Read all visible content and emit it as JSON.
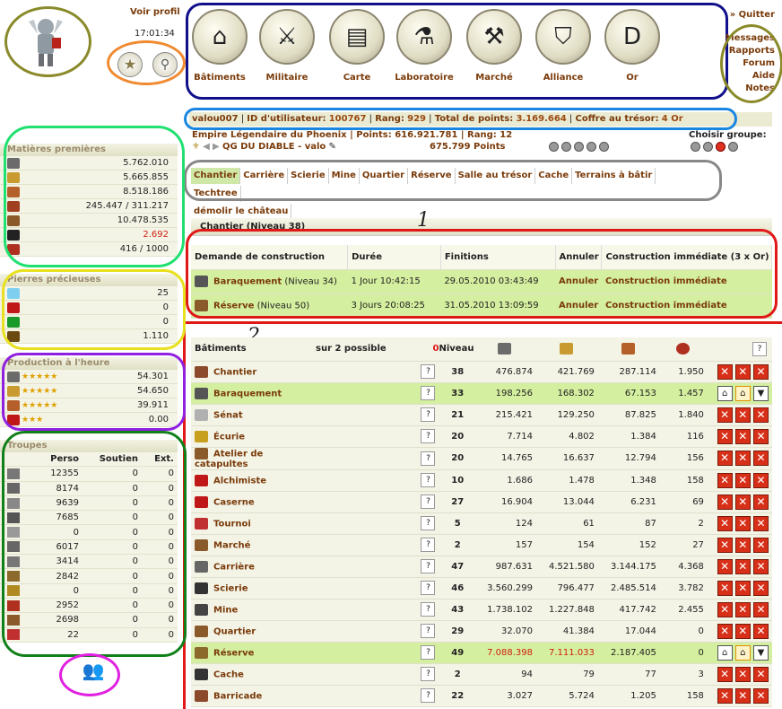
{
  "profile": {
    "voir_profil": "Voir profil",
    "time": "17:01:34"
  },
  "nav": [
    {
      "label": "Bâtiments",
      "icon": "house-icon",
      "glyph": "⌂"
    },
    {
      "label": "Militaire",
      "icon": "crossed-swords-icon",
      "glyph": "⚔"
    },
    {
      "label": "Carte",
      "icon": "map-icon",
      "glyph": "▤"
    },
    {
      "label": "Laboratoire",
      "icon": "flask-icon",
      "glyph": "⚗"
    },
    {
      "label": "Marché",
      "icon": "gavel-icon",
      "glyph": "⚒"
    },
    {
      "label": "Alliance",
      "icon": "shield-icon",
      "glyph": "⛉"
    },
    {
      "label": "Or",
      "icon": "gold-coin-icon",
      "glyph": "D"
    }
  ],
  "rightlinks": {
    "quit": "» Quitter",
    "messages": "Messages",
    "rapports": "Rapports",
    "forum": "Forum",
    "aide": "Aide",
    "notes": "Notes"
  },
  "userbar": {
    "user": "valou007",
    "id_label": "ID d'utilisateur:",
    "id": "100767",
    "rang_label": "Rang:",
    "rang": "929",
    "points_label": "Total de points:",
    "points": "3.169.664",
    "tresor_label": "Coffre au trésor:",
    "tresor": "4 Or"
  },
  "empire": {
    "line": "Empire Légendaire du Phoenix | Points: 616.921.781 | Rang: 12",
    "city": "QG DU DIABLE - valo",
    "city_points": "675.799 Points",
    "group_label": "Choisir groupe:"
  },
  "tabs": [
    "Chantier",
    "Carrière",
    "Scierie",
    "Mine",
    "Quartier",
    "Réserve",
    "Salle au trésor",
    "Cache",
    "Terrains à bâtir",
    "Techtree",
    "démolir le château"
  ],
  "chantier": {
    "title": "Chantier (Niveau 38)",
    "headers": [
      "Demande de construction",
      "Durée",
      "Finitions",
      "Annuler",
      "Construction immédiate (3 x Or)"
    ],
    "rows": [
      {
        "name": "Baraquement",
        "level": "(Niveau 34)",
        "duree": "1 Jour 10:42:15",
        "fin": "29.05.2010 03:43:49",
        "annuler": "Annuler",
        "imm": "Construction immédiate"
      },
      {
        "name": "Réserve",
        "level": "(Niveau 50)",
        "duree": "3 Jours 20:08:25",
        "fin": "31.05.2010 13:09:59",
        "annuler": "Annuler",
        "imm": "Construction immédiate"
      }
    ]
  },
  "batiments": {
    "header": "Bâtiments",
    "possible_n": "0",
    "possible": "sur 2 possible",
    "niveau": "Niveau",
    "q": "?",
    "rows": [
      {
        "name": "Chantier",
        "lvl": "38",
        "a": "476.874",
        "b": "421.769",
        "c": "287.114",
        "d": "1.950",
        "hl": false
      },
      {
        "name": "Baraquement",
        "lvl": "33",
        "a": "198.256",
        "b": "168.302",
        "c": "67.153",
        "d": "1.457",
        "hl": true
      },
      {
        "name": "Sénat",
        "lvl": "21",
        "a": "215.421",
        "b": "129.250",
        "c": "87.825",
        "d": "1.840",
        "hl": false
      },
      {
        "name": "Écurie",
        "lvl": "20",
        "a": "7.714",
        "b": "4.802",
        "c": "1.384",
        "d": "116",
        "hl": false
      },
      {
        "name": "Atelier de catapultes",
        "lvl": "20",
        "a": "14.765",
        "b": "16.637",
        "c": "12.794",
        "d": "156",
        "hl": false
      },
      {
        "name": "Alchimiste",
        "lvl": "10",
        "a": "1.686",
        "b": "1.478",
        "c": "1.348",
        "d": "158",
        "hl": false
      },
      {
        "name": "Caserne",
        "lvl": "27",
        "a": "16.904",
        "b": "13.044",
        "c": "6.231",
        "d": "69",
        "hl": false
      },
      {
        "name": "Tournoi",
        "lvl": "5",
        "a": "124",
        "b": "61",
        "c": "87",
        "d": "2",
        "hl": false
      },
      {
        "name": "Marché",
        "lvl": "2",
        "a": "157",
        "b": "154",
        "c": "152",
        "d": "27",
        "hl": false
      },
      {
        "name": "Carrière",
        "lvl": "47",
        "a": "987.631",
        "b": "4.521.580",
        "c": "3.144.175",
        "d": "4.368",
        "hl": false
      },
      {
        "name": "Scierie",
        "lvl": "46",
        "a": "3.560.299",
        "b": "796.477",
        "c": "2.485.514",
        "d": "3.782",
        "hl": false
      },
      {
        "name": "Mine",
        "lvl": "43",
        "a": "1.738.102",
        "b": "1.227.848",
        "c": "417.742",
        "d": "2.455",
        "hl": false
      },
      {
        "name": "Quartier",
        "lvl": "29",
        "a": "32.070",
        "b": "41.384",
        "c": "17.044",
        "d": "0",
        "hl": false
      },
      {
        "name": "Réserve",
        "lvl": "49",
        "a": "7.088.398",
        "b": "7.111.033",
        "c": "2.187.405",
        "d": "0",
        "hl": true,
        "red": true
      },
      {
        "name": "Cache",
        "lvl": "2",
        "a": "94",
        "b": "79",
        "c": "77",
        "d": "3",
        "hl": false
      },
      {
        "name": "Barricade",
        "lvl": "22",
        "a": "3.027",
        "b": "5.724",
        "c": "1.205",
        "d": "158",
        "hl": false
      }
    ]
  },
  "matieres": {
    "title": "Matières premières",
    "rows": [
      {
        "v": "5.762.010",
        "c": "#6b6b6b"
      },
      {
        "v": "5.665.855",
        "c": "#c89a30"
      },
      {
        "v": "8.518.186",
        "c": "#b5602a"
      },
      {
        "v": "245.447 / 311.217",
        "c": "#a04020"
      },
      {
        "v": "10.478.535",
        "c": "#8b5a2b"
      },
      {
        "v": "2.692",
        "c": "#222",
        "red": true
      },
      {
        "v": "416 / 1000",
        "c": "#b03020"
      }
    ]
  },
  "pierres": {
    "title": "Pierres précieuses",
    "rows": [
      {
        "v": "25",
        "c": "#7fd0f0"
      },
      {
        "v": "0",
        "c": "#c01818"
      },
      {
        "v": "0",
        "c": "#1a9a2a"
      },
      {
        "v": "1.110",
        "c": "#6a4a10"
      }
    ]
  },
  "production": {
    "title": "Production à l'heure",
    "rows": [
      {
        "v": "54.301",
        "stars": "★★★★★",
        "c": "#6b6b6b"
      },
      {
        "v": "54.650",
        "stars": "★★★★★",
        "c": "#c89a30"
      },
      {
        "v": "39.911",
        "stars": "★★★★★",
        "c": "#b5602a"
      },
      {
        "v": "0.00",
        "stars": "★★★",
        "c": "#c01818"
      }
    ]
  },
  "troupes": {
    "title": "Troupes",
    "headers": [
      "Perso",
      "Soutien",
      "Ext."
    ],
    "rows": [
      [
        "12355",
        "0",
        "0"
      ],
      [
        "8174",
        "0",
        "0"
      ],
      [
        "9639",
        "0",
        "0"
      ],
      [
        "7685",
        "0",
        "0"
      ],
      [
        "0",
        "0",
        "0"
      ],
      [
        "6017",
        "0",
        "0"
      ],
      [
        "3414",
        "0",
        "0"
      ],
      [
        "2842",
        "0",
        "0"
      ],
      [
        "0",
        "0",
        "0"
      ],
      [
        "2952",
        "0",
        "0"
      ],
      [
        "2698",
        "0",
        "0"
      ],
      [
        "22",
        "0",
        "0"
      ]
    ]
  },
  "annotations": {
    "one": "1",
    "two": "2"
  }
}
